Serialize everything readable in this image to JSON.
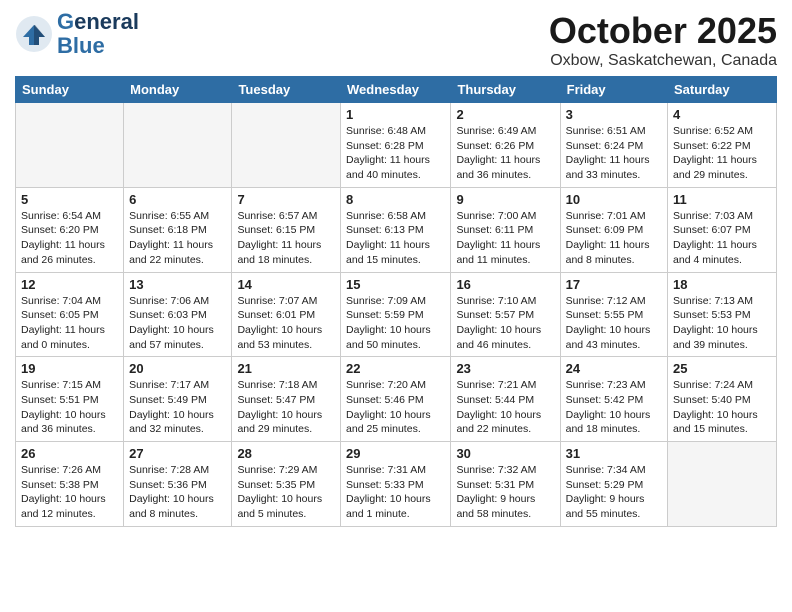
{
  "header": {
    "logo_line1_g": "G",
    "logo_line1_rest": "eneral",
    "logo_line2": "Blue",
    "month_title": "October 2025",
    "subtitle": "Oxbow, Saskatchewan, Canada"
  },
  "weekdays": [
    "Sunday",
    "Monday",
    "Tuesday",
    "Wednesday",
    "Thursday",
    "Friday",
    "Saturday"
  ],
  "weeks": [
    [
      {
        "num": "",
        "info": ""
      },
      {
        "num": "",
        "info": ""
      },
      {
        "num": "",
        "info": ""
      },
      {
        "num": "1",
        "info": "Sunrise: 6:48 AM\nSunset: 6:28 PM\nDaylight: 11 hours\nand 40 minutes."
      },
      {
        "num": "2",
        "info": "Sunrise: 6:49 AM\nSunset: 6:26 PM\nDaylight: 11 hours\nand 36 minutes."
      },
      {
        "num": "3",
        "info": "Sunrise: 6:51 AM\nSunset: 6:24 PM\nDaylight: 11 hours\nand 33 minutes."
      },
      {
        "num": "4",
        "info": "Sunrise: 6:52 AM\nSunset: 6:22 PM\nDaylight: 11 hours\nand 29 minutes."
      }
    ],
    [
      {
        "num": "5",
        "info": "Sunrise: 6:54 AM\nSunset: 6:20 PM\nDaylight: 11 hours\nand 26 minutes."
      },
      {
        "num": "6",
        "info": "Sunrise: 6:55 AM\nSunset: 6:18 PM\nDaylight: 11 hours\nand 22 minutes."
      },
      {
        "num": "7",
        "info": "Sunrise: 6:57 AM\nSunset: 6:15 PM\nDaylight: 11 hours\nand 18 minutes."
      },
      {
        "num": "8",
        "info": "Sunrise: 6:58 AM\nSunset: 6:13 PM\nDaylight: 11 hours\nand 15 minutes."
      },
      {
        "num": "9",
        "info": "Sunrise: 7:00 AM\nSunset: 6:11 PM\nDaylight: 11 hours\nand 11 minutes."
      },
      {
        "num": "10",
        "info": "Sunrise: 7:01 AM\nSunset: 6:09 PM\nDaylight: 11 hours\nand 8 minutes."
      },
      {
        "num": "11",
        "info": "Sunrise: 7:03 AM\nSunset: 6:07 PM\nDaylight: 11 hours\nand 4 minutes."
      }
    ],
    [
      {
        "num": "12",
        "info": "Sunrise: 7:04 AM\nSunset: 6:05 PM\nDaylight: 11 hours\nand 0 minutes."
      },
      {
        "num": "13",
        "info": "Sunrise: 7:06 AM\nSunset: 6:03 PM\nDaylight: 10 hours\nand 57 minutes."
      },
      {
        "num": "14",
        "info": "Sunrise: 7:07 AM\nSunset: 6:01 PM\nDaylight: 10 hours\nand 53 minutes."
      },
      {
        "num": "15",
        "info": "Sunrise: 7:09 AM\nSunset: 5:59 PM\nDaylight: 10 hours\nand 50 minutes."
      },
      {
        "num": "16",
        "info": "Sunrise: 7:10 AM\nSunset: 5:57 PM\nDaylight: 10 hours\nand 46 minutes."
      },
      {
        "num": "17",
        "info": "Sunrise: 7:12 AM\nSunset: 5:55 PM\nDaylight: 10 hours\nand 43 minutes."
      },
      {
        "num": "18",
        "info": "Sunrise: 7:13 AM\nSunset: 5:53 PM\nDaylight: 10 hours\nand 39 minutes."
      }
    ],
    [
      {
        "num": "19",
        "info": "Sunrise: 7:15 AM\nSunset: 5:51 PM\nDaylight: 10 hours\nand 36 minutes."
      },
      {
        "num": "20",
        "info": "Sunrise: 7:17 AM\nSunset: 5:49 PM\nDaylight: 10 hours\nand 32 minutes."
      },
      {
        "num": "21",
        "info": "Sunrise: 7:18 AM\nSunset: 5:47 PM\nDaylight: 10 hours\nand 29 minutes."
      },
      {
        "num": "22",
        "info": "Sunrise: 7:20 AM\nSunset: 5:46 PM\nDaylight: 10 hours\nand 25 minutes."
      },
      {
        "num": "23",
        "info": "Sunrise: 7:21 AM\nSunset: 5:44 PM\nDaylight: 10 hours\nand 22 minutes."
      },
      {
        "num": "24",
        "info": "Sunrise: 7:23 AM\nSunset: 5:42 PM\nDaylight: 10 hours\nand 18 minutes."
      },
      {
        "num": "25",
        "info": "Sunrise: 7:24 AM\nSunset: 5:40 PM\nDaylight: 10 hours\nand 15 minutes."
      }
    ],
    [
      {
        "num": "26",
        "info": "Sunrise: 7:26 AM\nSunset: 5:38 PM\nDaylight: 10 hours\nand 12 minutes."
      },
      {
        "num": "27",
        "info": "Sunrise: 7:28 AM\nSunset: 5:36 PM\nDaylight: 10 hours\nand 8 minutes."
      },
      {
        "num": "28",
        "info": "Sunrise: 7:29 AM\nSunset: 5:35 PM\nDaylight: 10 hours\nand 5 minutes."
      },
      {
        "num": "29",
        "info": "Sunrise: 7:31 AM\nSunset: 5:33 PM\nDaylight: 10 hours\nand 1 minute."
      },
      {
        "num": "30",
        "info": "Sunrise: 7:32 AM\nSunset: 5:31 PM\nDaylight: 9 hours\nand 58 minutes."
      },
      {
        "num": "31",
        "info": "Sunrise: 7:34 AM\nSunset: 5:29 PM\nDaylight: 9 hours\nand 55 minutes."
      },
      {
        "num": "",
        "info": ""
      }
    ]
  ]
}
